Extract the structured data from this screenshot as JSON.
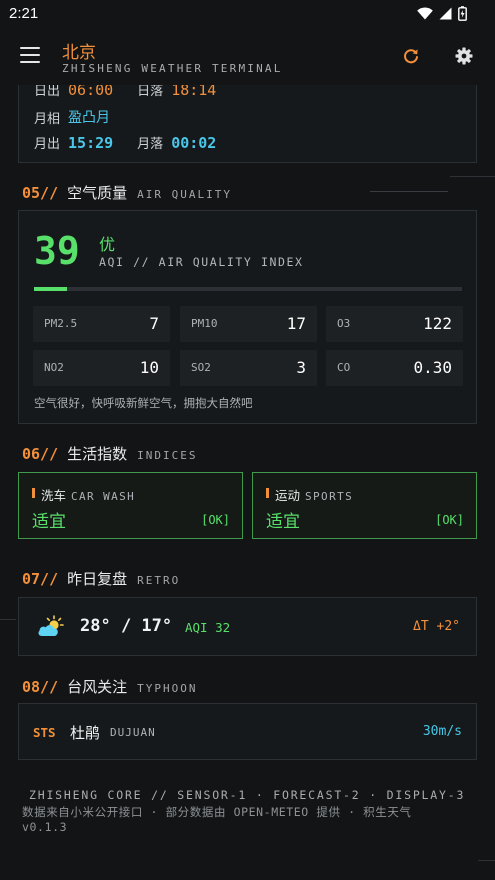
{
  "status_bar": {
    "time": "2:21"
  },
  "app_bar": {
    "city": "北京",
    "subtitle": "ZHISHENG WEATHER TERMINAL"
  },
  "sun_moon": {
    "row1": {
      "sunrise_label": "日出",
      "sunrise": "06:00",
      "sunset_label": "日落",
      "sunset": "18:14"
    },
    "moon_phase_label": "月相",
    "moon_phase": "盈凸月",
    "moonrise_label": "月出",
    "moonrise": "15:29",
    "moonset_label": "月落",
    "moonset": "00:02"
  },
  "air_quality": {
    "section_num": "05//",
    "section_cn": "空气质量",
    "section_en": "AIR QUALITY",
    "aqi": "39",
    "level": "优",
    "index_label": "AQI // AIR QUALITY INDEX",
    "progress_fraction": 0.078,
    "pollutants": [
      {
        "name": "PM2.5",
        "value": "7"
      },
      {
        "name": "PM10",
        "value": "17"
      },
      {
        "name": "O3",
        "value": "122"
      },
      {
        "name": "NO2",
        "value": "10"
      },
      {
        "name": "SO2",
        "value": "3"
      },
      {
        "name": "CO",
        "value": "0.30"
      }
    ],
    "note": "空气很好，快呼吸新鲜空气，拥抱大自然吧"
  },
  "indices": {
    "section_num": "06//",
    "section_cn": "生活指数",
    "section_en": "INDICES",
    "items": [
      {
        "name_cn": "洗车",
        "name_en": "CAR WASH",
        "value": "适宜",
        "tag": "[OK]"
      },
      {
        "name_cn": "运动",
        "name_en": "SPORTS",
        "value": "适宜",
        "tag": "[OK]"
      }
    ]
  },
  "retro": {
    "section_num": "07//",
    "section_cn": "昨日复盘",
    "section_en": "RETRO",
    "icon": "partly-cloudy-icon",
    "temps": "28° / 17°",
    "aqi": "AQI 32",
    "delta": "ΔT +2°"
  },
  "typhoon": {
    "section_num": "08//",
    "section_cn": "台风关注",
    "section_en": "TYPHOON",
    "status": "STS",
    "name_cn": "杜鹃",
    "name_en": "DUJUAN",
    "speed": "30m/s"
  },
  "footer": {
    "line1": "ZHISHENG CORE // SENSOR-1 · FORECAST-2 · DISPLAY-3",
    "line2": "数据来自小米公开接口 · 部分数据由 OPEN-METEO 提供 · 积生天气",
    "version": "v0.1.3"
  },
  "colors": {
    "accent": "#f2903c",
    "good": "#58e06a",
    "info": "#49c6e8",
    "background": "#121416"
  }
}
